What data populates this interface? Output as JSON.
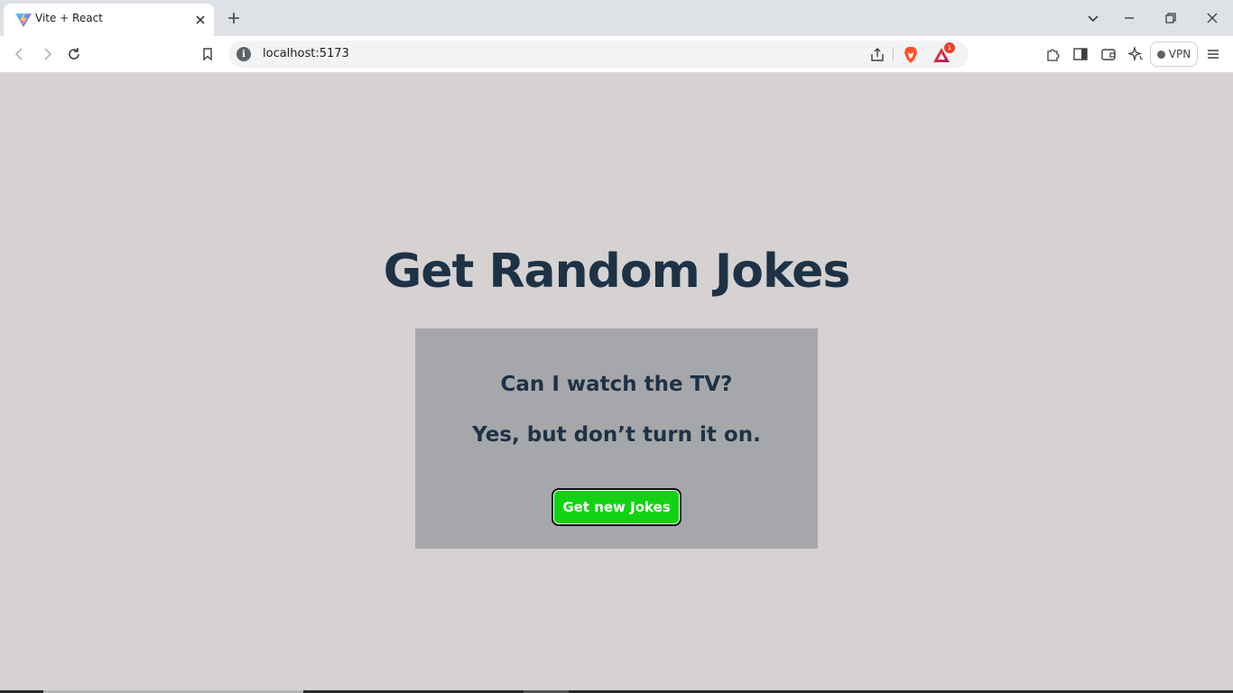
{
  "browser": {
    "tab": {
      "title": "Vite + React",
      "favicon": "vite-logo-icon"
    },
    "new_tab_icon": "plus-icon",
    "window_controls": [
      "tab-search-icon",
      "minimize-icon",
      "restore-icon",
      "close-icon"
    ],
    "address_bar": {
      "url": "localhost:5173",
      "rewards_badge_count": "1"
    },
    "vpn_label": "VPN"
  },
  "page": {
    "title": "Get Random Jokes",
    "joke": {
      "setup": "Can I watch the TV?",
      "punchline": "Yes, but don’t turn it on."
    },
    "button_label": "Get new Jokes",
    "colors": {
      "background": "#d6d2d2",
      "card": "#a6a7aa",
      "text": "#1e3246",
      "button": "#13d213"
    }
  }
}
